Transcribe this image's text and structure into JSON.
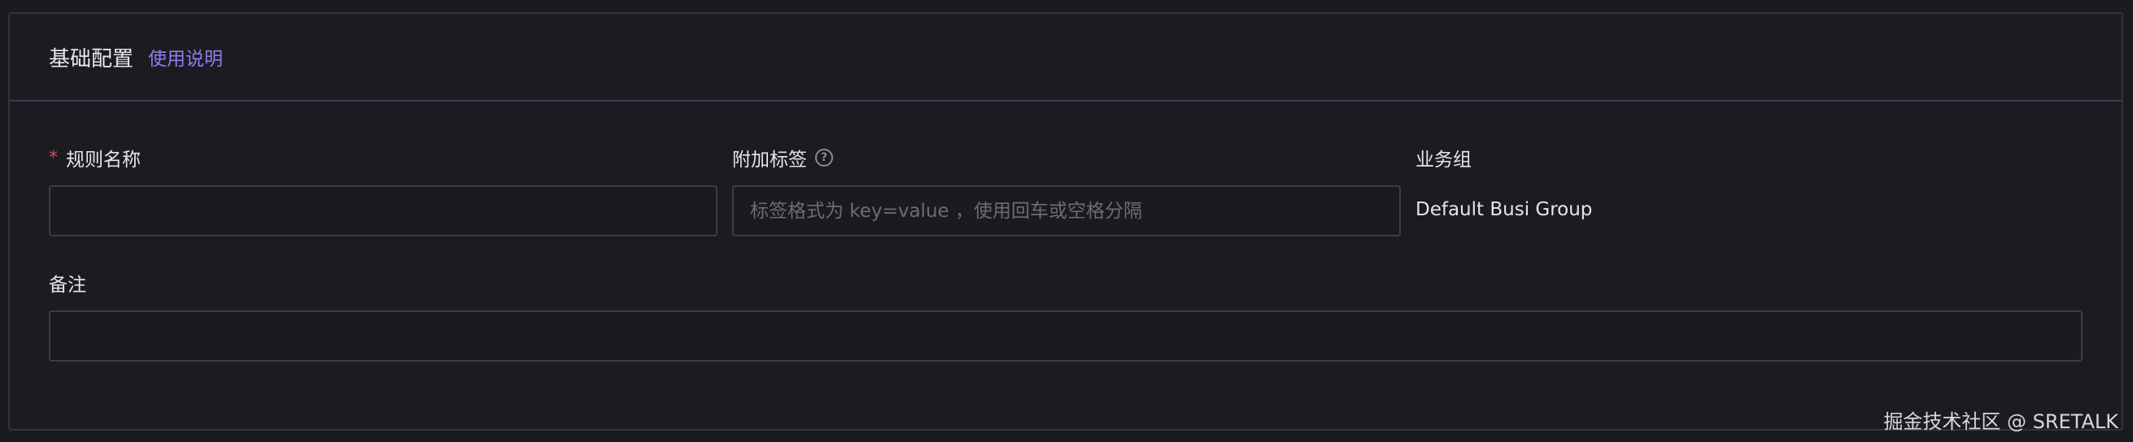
{
  "header": {
    "title": "基础配置",
    "help_link": "使用说明"
  },
  "fields": {
    "rule_name": {
      "required_mark": "*",
      "label": "规则名称",
      "value": "",
      "placeholder": ""
    },
    "tags": {
      "label": "附加标签",
      "value": "",
      "placeholder": "标签格式为 key=value ，使用回车或空格分隔"
    },
    "busi_group": {
      "label": "业务组",
      "value": "Default Busi Group"
    },
    "note": {
      "label": "备注",
      "value": "",
      "placeholder": ""
    }
  },
  "watermark": "掘金技术社区 @ SRETALK",
  "icons": {
    "tags_help": "question-circle-icon"
  }
}
